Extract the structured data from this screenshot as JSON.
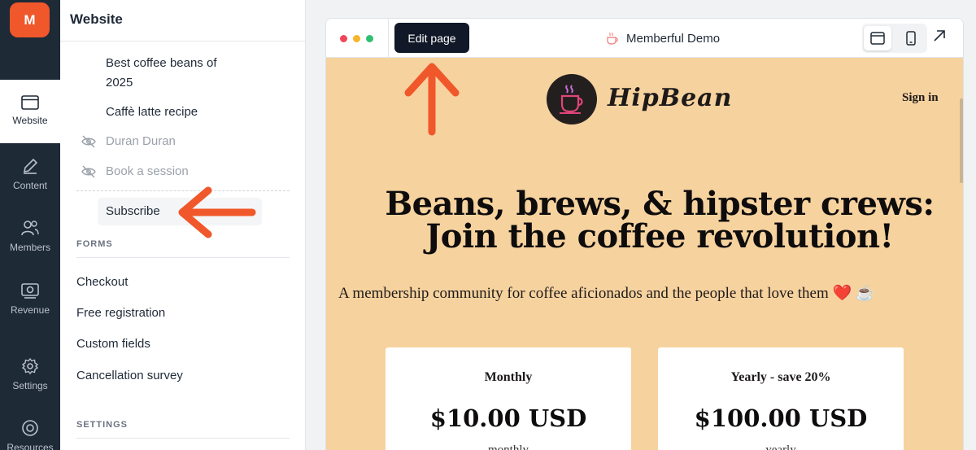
{
  "rail": {
    "logo_letter": "M",
    "items": [
      {
        "label": "Website",
        "icon": "browser-window-icon"
      },
      {
        "label": "Content",
        "icon": "pencil-icon"
      },
      {
        "label": "Members",
        "icon": "people-icon"
      },
      {
        "label": "Revenue",
        "icon": "money-icon"
      },
      {
        "label": "Settings",
        "icon": "gear-icon"
      },
      {
        "label": "Resources",
        "icon": "lifebuoy-icon"
      }
    ]
  },
  "panel": {
    "title": "Website",
    "pages": [
      {
        "label": "Best coffee beans of",
        "label2": "2025",
        "hidden": false
      },
      {
        "label": "Caffè latte recipe",
        "hidden": false
      },
      {
        "label": "Duran Duran",
        "hidden": true
      },
      {
        "label": "Book a session",
        "hidden": true
      },
      {
        "label": "Subscribe",
        "hidden": false,
        "highlighted": true
      }
    ],
    "forms_heading": "FORMS",
    "forms": [
      "Checkout",
      "Free registration",
      "Custom fields",
      "Cancellation survey"
    ],
    "settings_heading": "SETTINGS"
  },
  "browser": {
    "edit_label": "Edit page",
    "title": "Memberful Demo",
    "dots": [
      "#f0465a",
      "#f6b52a",
      "#2fbf71"
    ]
  },
  "site": {
    "brand": "HipBean",
    "sign_in": "Sign in",
    "headline_line1": "Beans, brews, & hipster crews:",
    "headline_line2": "Join the coffee revolution!",
    "subline": "A membership community for coffee aficionados and the people that love them ❤️ ☕",
    "plans": [
      {
        "name": "Monthly",
        "price": "$10.00 USD",
        "period": "monthly"
      },
      {
        "name": "Yearly - save 20%",
        "price": "$100.00 USD",
        "period": "yearly"
      }
    ]
  },
  "colors": {
    "accent": "#f0572b",
    "rail": "#1f2a37",
    "site_bg": "#f6d29e"
  }
}
